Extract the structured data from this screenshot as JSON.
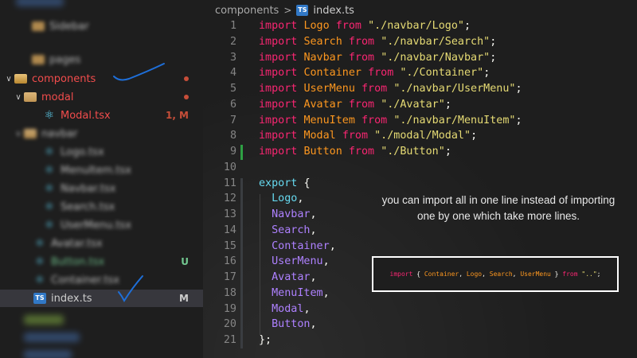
{
  "explorer": {
    "items": [
      {
        "label": "Sidebar",
        "blurred": true
      },
      {
        "label": "pages",
        "blurred": true
      },
      {
        "label": "components",
        "badge": "dot"
      },
      {
        "label": "modal",
        "badge": "dot"
      },
      {
        "label": "Modal.tsx",
        "badge": "1, M"
      },
      {
        "label": "navbar",
        "blurred": true
      },
      {
        "label": "Logo.tsx",
        "blurred": true
      },
      {
        "label": "MenuItem.tsx",
        "blurred": true
      },
      {
        "label": "Navbar.tsx",
        "blurred": true
      },
      {
        "label": "Search.tsx",
        "blurred": true
      },
      {
        "label": "UserMenu.tsx",
        "blurred": true
      },
      {
        "label": "Avatar.tsx",
        "blurred": true
      },
      {
        "label": "Button.tsx",
        "badge": "U",
        "blurred": true
      },
      {
        "label": "Container.tsx",
        "blurred": true
      },
      {
        "label": "index.ts",
        "badge": "M"
      }
    ]
  },
  "breadcrumb": {
    "folder": "components",
    "separator": ">",
    "file": "index.ts",
    "file_icon": "TS"
  },
  "code_lines": [
    {
      "n": "1",
      "text": "import Logo from \"./navbar/Logo\";"
    },
    {
      "n": "2",
      "text": "import Search from \"./navbar/Search\";"
    },
    {
      "n": "3",
      "text": "import Navbar from \"./navbar/Navbar\";"
    },
    {
      "n": "4",
      "text": "import Container from \"./Container\";"
    },
    {
      "n": "5",
      "text": "import UserMenu from \"./navbar/UserMenu\";"
    },
    {
      "n": "6",
      "text": "import Avatar from \"./Avatar\";"
    },
    {
      "n": "7",
      "text": "import MenuItem from \"./navbar/MenuItem\";"
    },
    {
      "n": "8",
      "text": "import Modal from \"./modal/Modal\";"
    },
    {
      "n": "9",
      "text": "import Button from \"./Button\";"
    },
    {
      "n": "10",
      "text": ""
    },
    {
      "n": "11",
      "text": "export {"
    },
    {
      "n": "12",
      "text": "  Logo,"
    },
    {
      "n": "13",
      "text": "  Navbar,"
    },
    {
      "n": "14",
      "text": "  Search,"
    },
    {
      "n": "15",
      "text": "  Container,"
    },
    {
      "n": "16",
      "text": "  UserMenu,"
    },
    {
      "n": "17",
      "text": "  Avatar,"
    },
    {
      "n": "18",
      "text": "  MenuItem,"
    },
    {
      "n": "19",
      "text": "  Modal,"
    },
    {
      "n": "20",
      "text": "  Button,"
    },
    {
      "n": "21",
      "text": "};"
    }
  ],
  "callout": {
    "text": "you can import all in one line instead of importing one by one which take more lines.",
    "code": "import { Container, Logo, Search, UserMenu } from \"..\";"
  },
  "colors": {
    "keyword": "#f92672",
    "identifier": "#fd971f",
    "string": "#e6db74",
    "export_member": "#ae81ff",
    "annotation_stroke": "#1e6fd9",
    "folder_label": "#f14c4c",
    "untracked": "#73c991"
  }
}
